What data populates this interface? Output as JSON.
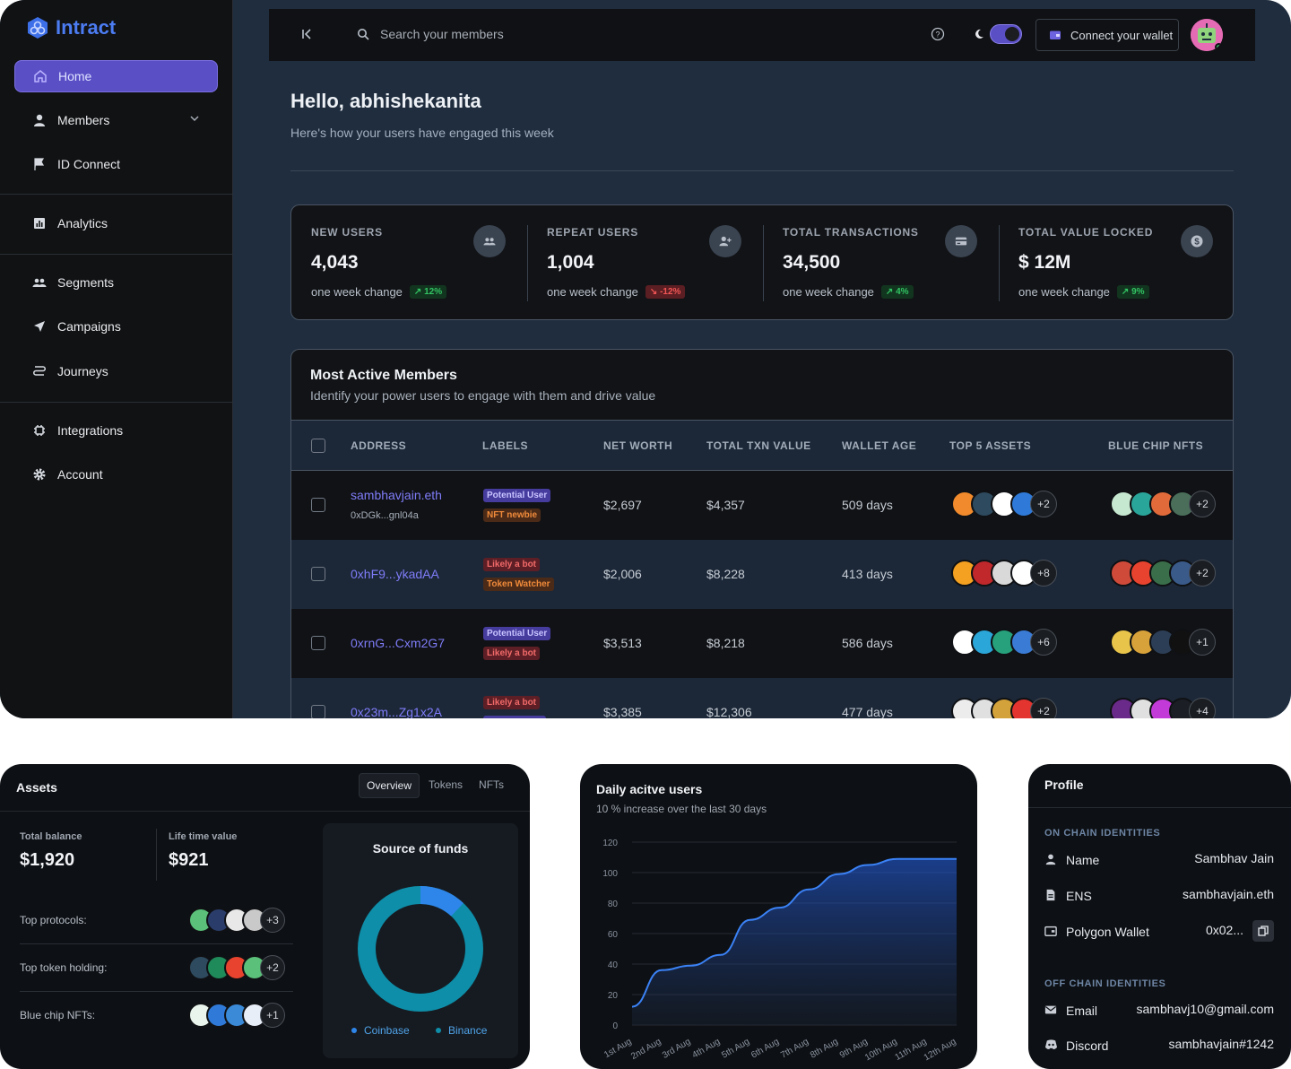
{
  "app": {
    "name": "Intract"
  },
  "sidebar": {
    "items": [
      {
        "label": "Home"
      },
      {
        "label": "Members"
      },
      {
        "label": "ID Connect"
      },
      {
        "label": "Analytics"
      },
      {
        "label": "Segments"
      },
      {
        "label": "Campaigns"
      },
      {
        "label": "Journeys"
      },
      {
        "label": "Integrations"
      },
      {
        "label": "Account"
      }
    ]
  },
  "topbar": {
    "search_placeholder": "Search your members",
    "wallet_label": "Connect your wallet"
  },
  "greeting": {
    "title": "Hello, abhishekanita",
    "subtitle": "Here's how your users have engaged this week"
  },
  "stats": [
    {
      "label": "NEW USERS",
      "value": "4,043",
      "change_label": "one week change",
      "change": "12%",
      "direction": "up"
    },
    {
      "label": "REPEAT USERS",
      "value": "1,004",
      "change_label": "one week change",
      "change": "-12%",
      "direction": "down"
    },
    {
      "label": "TOTAL TRANSACTIONS",
      "value": "34,500",
      "change_label": "one week change",
      "change": "4%",
      "direction": "up"
    },
    {
      "label": "TOTAL VALUE LOCKED",
      "value": "$ 12M",
      "change_label": "one week change",
      "change": "9%",
      "direction": "up"
    }
  ],
  "members": {
    "title": "Most Active Members",
    "subtitle": "Identify your power users to engage with them and drive value",
    "columns": [
      "ADDRESS",
      "LABELS",
      "NET WORTH",
      "TOTAL TXN VALUE",
      "WALLET AGE",
      "TOP 5 ASSETS",
      "BLUE CHIP NFTS"
    ],
    "rows": [
      {
        "address": "sambhavjain.eth",
        "sub": "0xDGk...gnl04a",
        "labels": [
          "Potential User",
          "NFT newbie"
        ],
        "net_worth": "$2,697",
        "txn": "$4,357",
        "age": "509 days",
        "assets_more": "+2",
        "nfts_more": "+2"
      },
      {
        "address": "0xhF9...ykadAA",
        "sub": "",
        "labels": [
          "Likely a bot",
          "Token Watcher"
        ],
        "net_worth": "$2,006",
        "txn": "$8,228",
        "age": "413 days",
        "assets_more": "+8",
        "nfts_more": "+2"
      },
      {
        "address": "0xrnG...Cxm2G7",
        "sub": "",
        "labels": [
          "Potential User",
          "Likely a bot"
        ],
        "net_worth": "$3,513",
        "txn": "$8,218",
        "age": "586 days",
        "assets_more": "+6",
        "nfts_more": "+1"
      },
      {
        "address": "0x23m...Zg1x2A",
        "sub": "",
        "labels": [
          "Likely a bot",
          ""
        ],
        "net_worth": "$3,385",
        "txn": "$12,306",
        "age": "477 days",
        "assets_more": "+2",
        "nfts_more": "+4"
      }
    ]
  },
  "assets": {
    "title": "Assets",
    "tabs": [
      "Overview",
      "Tokens",
      "NFTs"
    ],
    "total_balance_label": "Total balance",
    "total_balance": "$1,920",
    "lifetime_label": "Life time value",
    "lifetime": "$921",
    "rows": [
      {
        "label": "Top protocols:",
        "more": "+3"
      },
      {
        "label": "Top token holding:",
        "more": "+2"
      },
      {
        "label": "Blue chip NFTs:",
        "more": "+1"
      }
    ],
    "source_title": "Source of funds",
    "source": [
      {
        "name": "Coinbase",
        "value": 88,
        "color": "#0e8ea8"
      },
      {
        "name": "Binance",
        "value": 12,
        "color": "#2e86ea"
      }
    ]
  },
  "dau": {
    "title": "Daily acitve users",
    "subtitle": "10 % increase over the last 30 days"
  },
  "chart_data": {
    "type": "area",
    "x": [
      "1st Aug",
      "2nd Aug",
      "3rd Aug",
      "4th Aug",
      "5th Aug",
      "6th Aug",
      "7th Aug",
      "8th Aug",
      "9th Aug",
      "10th Aug",
      "11th Aug",
      "12th Aug"
    ],
    "values": [
      12,
      36,
      39,
      46,
      69,
      77,
      89,
      99,
      105,
      109,
      109,
      109
    ],
    "yticks": [
      0,
      20,
      40,
      60,
      80,
      100,
      120
    ],
    "ylim": [
      0,
      120
    ],
    "grid": true,
    "color": "#3b82f6"
  },
  "profile": {
    "title": "Profile",
    "on_chain_label": "ON CHAIN IDENTITIES",
    "on_chain": [
      {
        "key": "Name",
        "value": "Sambhav Jain",
        "icon": "person-icon"
      },
      {
        "key": "ENS",
        "value": "sambhavjain.eth",
        "icon": "document-icon"
      },
      {
        "key": "Polygon Wallet",
        "value": "0x02...",
        "icon": "wallet-icon"
      }
    ],
    "off_chain_label": "OFF CHAIN IDENTITIES",
    "off_chain": [
      {
        "key": "Email",
        "value": "sambhavj10@gmail.com",
        "icon": "mail-icon"
      },
      {
        "key": "Discord",
        "value": "sambhavjain#1242",
        "icon": "discord-icon"
      }
    ]
  }
}
